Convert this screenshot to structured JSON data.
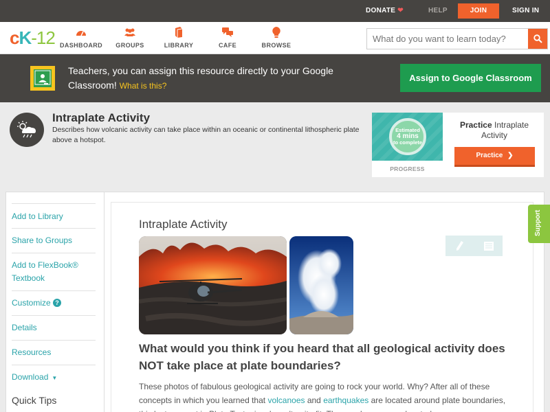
{
  "topbar": {
    "donate": "DONATE",
    "help": "HELP",
    "join": "JOIN",
    "signin": "SIGN IN"
  },
  "logo": {
    "ck": "cK",
    "num": "-12"
  },
  "nav": [
    {
      "label": "DASHBOARD",
      "icon": "dashboard-icon"
    },
    {
      "label": "GROUPS",
      "icon": "groups-icon"
    },
    {
      "label": "LIBRARY",
      "icon": "library-icon"
    },
    {
      "label": "CAFE",
      "icon": "cafe-icon"
    },
    {
      "label": "BROWSE",
      "icon": "browse-icon"
    }
  ],
  "search": {
    "placeholder": "What do you want to learn today?"
  },
  "banner": {
    "text": "Teachers, you can assign this resource directly to your Google Classroom!",
    "link": "What is this?",
    "button": "Assign to Google Classroom"
  },
  "concept": {
    "title": "Intraplate Activity",
    "description": "Describes how volcanic activity can take place within an oceanic or continental lithospheric plate above a hotspot."
  },
  "practice": {
    "estimated": "Estimated",
    "mins": "4 mins",
    "to_complete": "to complete",
    "progress": "PROGRESS",
    "title_bold": "Practice",
    "title_rest": "Intraplate Activity",
    "button": "Practice"
  },
  "sidebar": {
    "items": [
      {
        "label": "Add to Library"
      },
      {
        "label": "Share to Groups"
      },
      {
        "label": "Add to FlexBook® Textbook"
      },
      {
        "label": "Customize"
      },
      {
        "label": "Details"
      },
      {
        "label": "Resources"
      },
      {
        "label": "Download"
      }
    ],
    "customize_badge": "?",
    "quick_tips": "Quick Tips"
  },
  "content": {
    "title": "Intraplate Activity",
    "question": "What would you think if you heard that all geological activity does NOT take place at plate boundaries?",
    "para_1": "These photos of fabulous geological activity are going to rock your world. Why? After all of these concepts in which you learned that ",
    "link_volcanoes": "volcanoes",
    "para_and": " and ",
    "link_earthquakes": "earthquakes",
    "para_2": " are located around plate boundaries, this last concept in Plate Tectonics doesn't quite fit. These volcanoes are located"
  },
  "support": "Support",
  "colors": {
    "accent_orange": "#f0622c",
    "teal": "#2aa3a9",
    "google_green": "#1e9c4f",
    "dark_bar": "#464441",
    "support_green": "#8cc63f"
  }
}
